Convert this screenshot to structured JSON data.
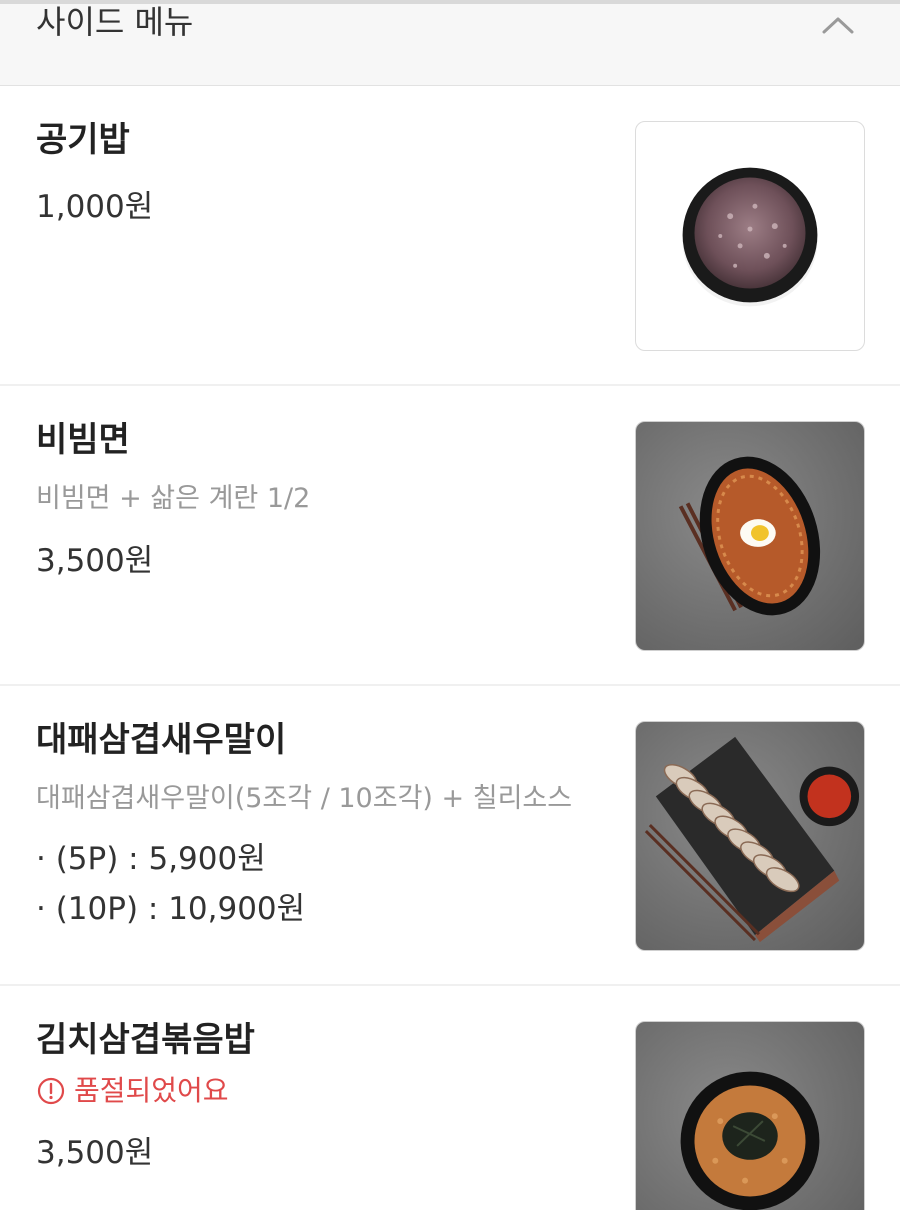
{
  "section": {
    "title": "사이드 메뉴",
    "collapse_icon": "chevron-up-icon"
  },
  "items": [
    {
      "name": "공기밥",
      "price": "1,000원",
      "image": "rice-bowl-photo"
    },
    {
      "name": "비빔면",
      "description": "비빔면 + 삶은 계란 1/2",
      "price": "3,500원",
      "image": "bibim-noodles-photo"
    },
    {
      "name": "대패삼겹새우말이",
      "description": "대패삼겹새우말이(5조각 / 10조각) + 칠리소스",
      "options": [
        "· (5P) : 5,900원",
        "· (10P) : 10,900원"
      ],
      "image": "pork-shrimp-rolls-photo"
    },
    {
      "name": "김치삼겹볶음밥",
      "status": "품절되었어요",
      "price": "3,500원",
      "image": "kimchi-fried-rice-photo"
    }
  ],
  "colors": {
    "soldout": "#e0494a",
    "header_bg": "#f7f7f7"
  }
}
